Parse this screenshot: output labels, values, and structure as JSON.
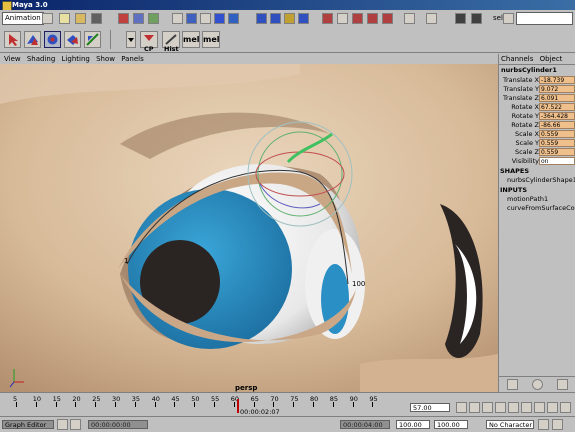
{
  "window": {
    "title": "Maya 3.0"
  },
  "toolbar1": {
    "menu_set": "Animation",
    "sel_label": "sel",
    "sel_value": ""
  },
  "toolbar2": {
    "cp_label": "CP",
    "hist_label": "Hist",
    "mel1": "mel",
    "mel2": "mel"
  },
  "panel_menu": [
    "View",
    "Shading",
    "Lighting",
    "Show",
    "Panels"
  ],
  "viewport": {
    "camera_label": "persp",
    "path_label_start": "1",
    "path_label_end": "100",
    "colors": {
      "iris": "#2a8fc4",
      "skin": "#d9bd9c",
      "pupil": "#2a2422"
    }
  },
  "channel_box": {
    "tabs": [
      "Channels",
      "Object"
    ],
    "node_name": "nurbsCylinder1",
    "channels": [
      {
        "label": "Translate X",
        "value": "-18.739"
      },
      {
        "label": "Translate Y",
        "value": "9.072"
      },
      {
        "label": "Translate Z",
        "value": "6.091"
      },
      {
        "label": "Rotate X",
        "value": "67.522"
      },
      {
        "label": "Rotate Y",
        "value": "-364.428"
      },
      {
        "label": "Rotate Z",
        "value": "-86.66"
      },
      {
        "label": "Scale X",
        "value": "0.559"
      },
      {
        "label": "Scale Y",
        "value": "0.559"
      },
      {
        "label": "Scale Z",
        "value": "0.559"
      },
      {
        "label": "Visibility",
        "value": "on"
      }
    ],
    "shapes_header": "SHAPES",
    "shape_name": "nurbsCylinderShape1",
    "inputs_header": "INPUTS",
    "inputs": [
      "motionPath1",
      "curveFromSurfaceCo"
    ]
  },
  "time_slider": {
    "ticks": [
      "5",
      "10",
      "15",
      "20",
      "25",
      "30",
      "35",
      "40",
      "45",
      "50",
      "55",
      "60",
      "65",
      "70",
      "75",
      "80",
      "85",
      "90",
      "95"
    ],
    "current_frame": "57.00",
    "timecode": "00:00:02:07"
  },
  "status_bar": {
    "graph_editor_label": "Graph Editor",
    "start_time": "00:00:00:00",
    "end_time": "00:00:04:00",
    "range_start": "100.00",
    "range_end": "100.00",
    "character": "No Character"
  }
}
